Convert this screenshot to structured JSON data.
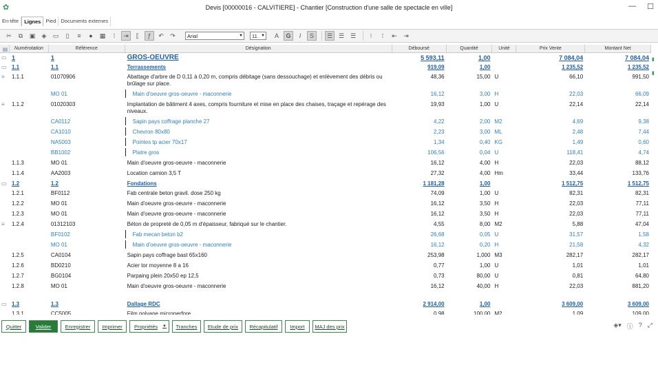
{
  "window": {
    "title": "Devis [00000016 - CALVITIERE] - Chantier [Construction d'une salle de spectacle en ville]",
    "minimize": "—",
    "maximize": "☐"
  },
  "tabs": [
    {
      "label": "En-tête"
    },
    {
      "label": "Lignes"
    },
    {
      "label": "Pied"
    },
    {
      "label": "Documents externes"
    }
  ],
  "toolbar": {
    "font": "Arial",
    "size": "11"
  },
  "columns": {
    "numerotation": "Numérotation",
    "reference": "Référence",
    "designation": "Désignation",
    "debourse": "Déboursé",
    "quantite": "Quantité",
    "unite": "Unité",
    "prix_vente": "Prix Vente",
    "montant_net": "Montant Net"
  },
  "rows": [
    {
      "type": "section",
      "num": "1",
      "ref": "1",
      "des": "GROS-OEUVRE",
      "deb": "5 593,11",
      "qty": "1,00",
      "uni": "",
      "pv": "7 084,04",
      "mn": "7 084,04"
    },
    {
      "type": "section2",
      "num": "1.1",
      "ref": "1.1",
      "des": "Terrassements",
      "deb": "919,09",
      "qty": "1,00",
      "uni": "",
      "pv": "1 235,52",
      "mn": "1 235,52"
    },
    {
      "type": "item",
      "num": "1.1.1",
      "ref": "01070906",
      "des": "Abattage d'arbre de D 0,11 à 0,20 m, compris débitage (sans dessouchage) et enlèvement des débris ou brûlage sur place.",
      "deb": "48,36",
      "qty": "15,00",
      "uni": "U",
      "pv": "66,10",
      "mn": "991,50",
      "lines": 2
    },
    {
      "type": "sub",
      "num": "",
      "ref": "MO 01",
      "des": "Main d'oeuvre gros-oeuvre - maconnerie",
      "deb": "16,12",
      "qty": "3,00",
      "uni": "H",
      "pv": "22,03",
      "mn": "66,09"
    },
    {
      "type": "item",
      "num": "1.1.2",
      "ref": "01020303",
      "des": "Implantation de bâtiment 4 axes, compris fourniture et mise en place des chaises, traçage et repérage des niveaux.",
      "deb": "19,93",
      "qty": "1,00",
      "uni": "U",
      "pv": "22,14",
      "mn": "22,14",
      "lines": 2
    },
    {
      "type": "sub",
      "num": "",
      "ref": "CA0112",
      "des": "Sapin pays coffrage planche 27",
      "deb": "4,22",
      "qty": "2,00",
      "uni": "M2",
      "pv": "4,69",
      "mn": "9,38"
    },
    {
      "type": "sub",
      "num": "",
      "ref": "CA1010",
      "des": "Chevron 80x80",
      "deb": "2,23",
      "qty": "3,00",
      "uni": "ML",
      "pv": "2,48",
      "mn": "7,44"
    },
    {
      "type": "sub",
      "num": "",
      "ref": "NA5003",
      "des": "Pointes tp acier 70x17",
      "deb": "1,34",
      "qty": "0,40",
      "uni": "KG",
      "pv": "1,49",
      "mn": "0,60"
    },
    {
      "type": "sub",
      "num": "",
      "ref": "BB1002",
      "des": "Platre gros",
      "deb": "106,56",
      "qty": "0,04",
      "uni": "U",
      "pv": "118,41",
      "mn": "4,74"
    },
    {
      "type": "item",
      "num": "1.1.3",
      "ref": "MO 01",
      "des": "Main d'oeuvre gros-oeuvre - maconnerie",
      "deb": "16,12",
      "qty": "4,00",
      "uni": "H",
      "pv": "22,03",
      "mn": "88,12"
    },
    {
      "type": "item",
      "num": "1.1.4",
      "ref": "AA2003",
      "des": "Location camion 3,5 T",
      "deb": "27,32",
      "qty": "4,00",
      "uni": "Hm",
      "pv": "33,44",
      "mn": "133,76"
    },
    {
      "type": "section2",
      "num": "1.2",
      "ref": "1.2",
      "des": "Fondations",
      "deb": "1 181,28",
      "qty": "1,00",
      "uni": "",
      "pv": "1 512,75",
      "mn": "1 512,75"
    },
    {
      "type": "item",
      "num": "1.2.1",
      "ref": "BF0112",
      "des": "Fab centrale beton gravil. dose 250 kg",
      "deb": "74,09",
      "qty": "1,00",
      "uni": "U",
      "pv": "82,31",
      "mn": "82,31"
    },
    {
      "type": "item",
      "num": "1.2.2",
      "ref": "MO 01",
      "des": "Main d'oeuvre gros-oeuvre - maconnerie",
      "deb": "16,12",
      "qty": "3,50",
      "uni": "H",
      "pv": "22,03",
      "mn": "77,11"
    },
    {
      "type": "item",
      "num": "1.2.3",
      "ref": "MO 01",
      "des": "Main d'oeuvre gros-oeuvre - maconnerie",
      "deb": "16,12",
      "qty": "3,50",
      "uni": "H",
      "pv": "22,03",
      "mn": "77,11"
    },
    {
      "type": "item",
      "num": "1.2.4",
      "ref": "01312103",
      "des": "Béton de propreté de 0,05 m d'épaisseur, fabriqué sur le chantier.",
      "deb": "4,55",
      "qty": "8,00",
      "uni": "M2",
      "pv": "5,88",
      "mn": "47,04"
    },
    {
      "type": "sub",
      "num": "",
      "ref": "BF0102",
      "des": "Fab mecan beton b2",
      "deb": "26,68",
      "qty": "0,05",
      "uni": "U",
      "pv": "31,57",
      "mn": "1,58"
    },
    {
      "type": "sub",
      "num": "",
      "ref": "MO 01",
      "des": "Main d'oeuvre gros-oeuvre - maconnerie",
      "deb": "16,12",
      "qty": "0,20",
      "uni": "H",
      "pv": "21,58",
      "mn": "4,32"
    },
    {
      "type": "item",
      "num": "1.2.5",
      "ref": "CA0104",
      "des": "Sapin pays coffrage bast 65x160",
      "deb": "253,98",
      "qty": "1,000",
      "uni": "M3",
      "pv": "282,17",
      "mn": "282,17"
    },
    {
      "type": "item",
      "num": "1.2.6",
      "ref": "BD0210",
      "des": "Acier tor moyenne 8 a 16",
      "deb": "0,77",
      "qty": "1,00",
      "uni": "U",
      "pv": "1,01",
      "mn": "1,01"
    },
    {
      "type": "item",
      "num": "1.2.7",
      "ref": "BG0104",
      "des": "Parpaing plein 20x50 ep 12,5",
      "deb": "0,73",
      "qty": "80,00",
      "uni": "U",
      "pv": "0,81",
      "mn": "64,80"
    },
    {
      "type": "item",
      "num": "1.2.8",
      "ref": "MO 01",
      "des": "Main d'oeuvre gros-oeuvre - maconnerie",
      "deb": "16,12",
      "qty": "40,00",
      "uni": "H",
      "pv": "22,03",
      "mn": "881,20"
    },
    {
      "type": "blank",
      "num": "",
      "ref": "",
      "des": "",
      "deb": "",
      "qty": "",
      "uni": "",
      "pv": "",
      "mn": ""
    },
    {
      "type": "section2",
      "num": "1.3",
      "ref": "1.3",
      "des": "Dallage RDC",
      "deb": "2 914,00",
      "qty": "1,00",
      "uni": "",
      "pv": "3 609,00",
      "mn": "3 609,00"
    },
    {
      "type": "item",
      "num": "1.3.1",
      "ref": "CC5005",
      "des": "Film polyane microperfore",
      "deb": "0,98",
      "qty": "100,00",
      "uni": "M2",
      "pv": "1,09",
      "mn": "109,00"
    }
  ],
  "buttons": {
    "quitter": "Quitter",
    "valider": "Valider",
    "enregistrer": "Enregistrer",
    "imprimer": "Imprimer",
    "proprietes": "Propriétés",
    "tranches": "Tranches",
    "etude": "Etude de prix",
    "recap": "Récapitulatif",
    "import": "Import",
    "maj": "MAJ des prix"
  }
}
